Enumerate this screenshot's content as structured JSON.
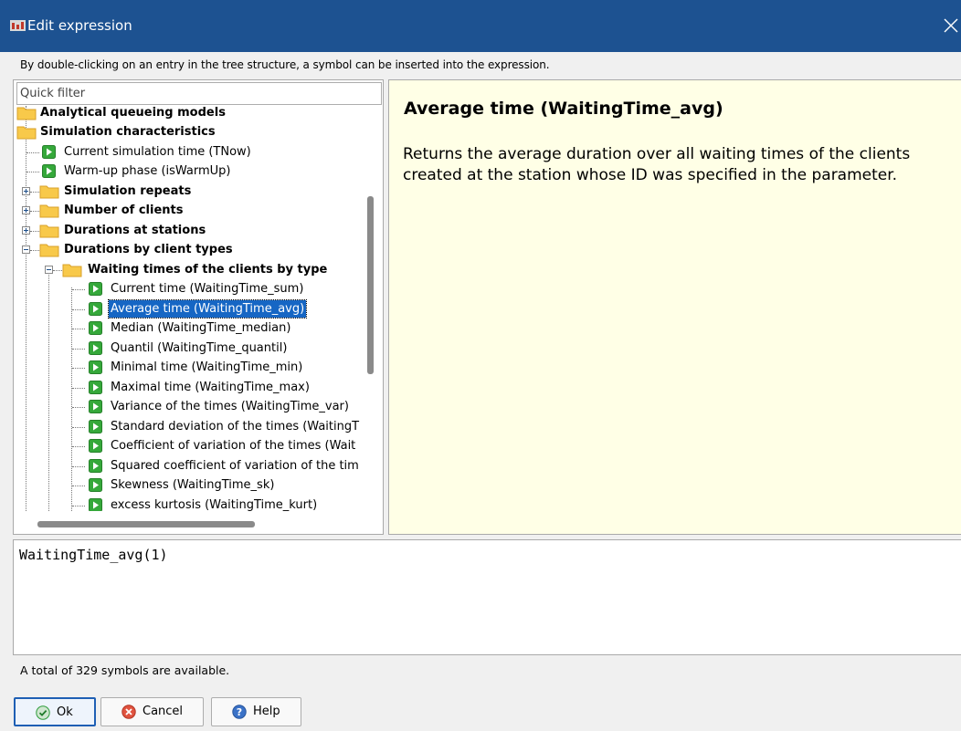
{
  "window": {
    "title": "Edit expression"
  },
  "hint": "By double-clicking on an entry in the tree structure, a symbol can be inserted into the expression.",
  "filter": {
    "placeholder": "Quick filter",
    "value": ""
  },
  "tree": {
    "items": [
      {
        "label": "Analytical queueing models"
      },
      {
        "label": "Simulation characteristics"
      },
      {
        "label": "Current simulation time (TNow)"
      },
      {
        "label": "Warm-up phase (isWarmUp)"
      },
      {
        "label": "Simulation repeats"
      },
      {
        "label": "Number of clients"
      },
      {
        "label": "Durations at stations"
      },
      {
        "label": "Durations by client types"
      },
      {
        "label": "Waiting times of the clients by type"
      },
      {
        "label": "Current time (WaitingTime_sum)"
      },
      {
        "label": "Average time (WaitingTime_avg)"
      },
      {
        "label": "Median (WaitingTime_median)"
      },
      {
        "label": "Quantil (WaitingTime_quantil)"
      },
      {
        "label": "Minimal time (WaitingTime_min)"
      },
      {
        "label": "Maximal time (WaitingTime_max)"
      },
      {
        "label": "Variance of the times (WaitingTime_var)"
      },
      {
        "label": "Standard deviation of the times (WaitingT"
      },
      {
        "label": "Coefficient of variation of the times (Wait"
      },
      {
        "label": "Squared coefficient of variation of the tim"
      },
      {
        "label": "Skewness (WaitingTime_sk)"
      },
      {
        "label": "excess kurtosis (WaitingTime_kurt)"
      }
    ]
  },
  "description": {
    "title": "Average time (WaitingTime_avg)",
    "body": "Returns the average duration over all waiting times of the clients created at the station whose ID was specified in the parameter."
  },
  "expression": {
    "value": "WaitingTime_avg(1)"
  },
  "status": "A total of 329 symbols are available.",
  "buttons": {
    "ok": "Ok",
    "cancel": "Cancel",
    "help": "Help"
  },
  "colors": {
    "titlebar": "#1d5291",
    "selection": "#1666c4",
    "description_bg": "#ffffe6",
    "folder": "#f8c94a",
    "leaf_icon": "#35a83a"
  }
}
